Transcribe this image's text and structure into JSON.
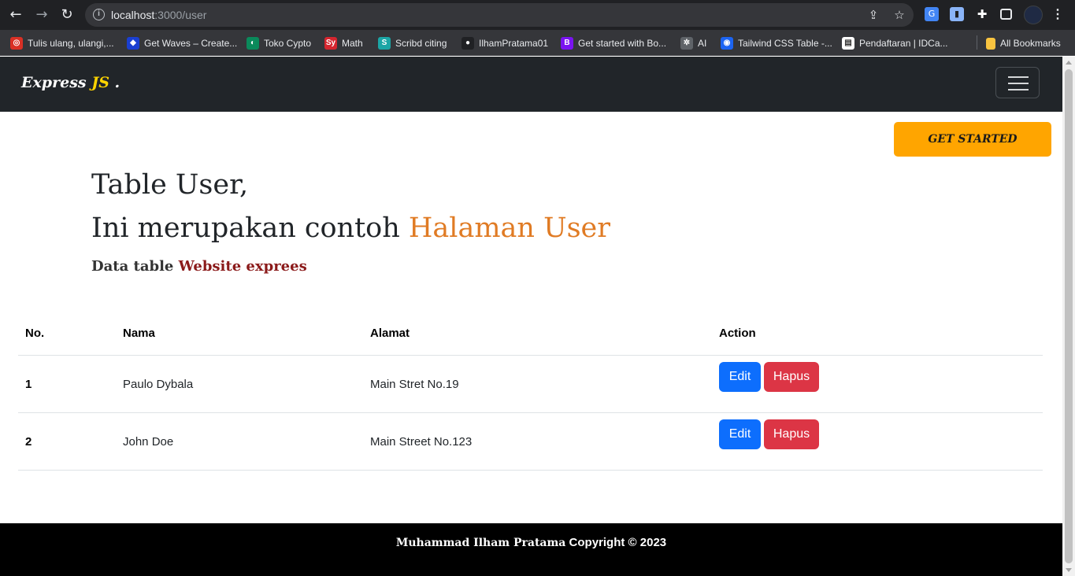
{
  "browser": {
    "url_host": "localhost",
    "url_rest": ":3000/user",
    "bookmarks": [
      {
        "label": "Tulis ulang, ulangi,...",
        "icon": "quillbot-icon",
        "color": "#d93025"
      },
      {
        "label": "Get Waves – Create...",
        "icon": "waves-icon",
        "color": "#1a3fd1"
      },
      {
        "label": "Toko Cypto",
        "icon": "crypto-icon",
        "color": "#0a8a5b"
      },
      {
        "label": "Math",
        "icon": "symbolab-icon",
        "color": "#d6262f"
      },
      {
        "label": "Scribd citing",
        "icon": "scribd-icon",
        "color": "#1ba5a5"
      },
      {
        "label": "IlhamPratama01",
        "icon": "github-icon",
        "color": "#202124"
      },
      {
        "label": "Get started with Bo...",
        "icon": "bootstrap-icon",
        "color": "#7a13f0"
      },
      {
        "label": "AI",
        "icon": "openai-icon",
        "color": "#5f6368"
      },
      {
        "label": "Tailwind CSS Table -...",
        "icon": "flowbite-icon",
        "color": "#1c64f2"
      },
      {
        "label": "Pendaftaran | IDCa...",
        "icon": "idcamp-icon",
        "color": "#ffffff"
      }
    ],
    "all_bookmarks": "All Bookmarks"
  },
  "navbar": {
    "brand_main": "Express ",
    "brand_js": "JS",
    "brand_dot": " ."
  },
  "hero": {
    "cta": "GET STARTED",
    "title_line1": "Table User,",
    "title_line2_prefix": "Ini merupakan contoh ",
    "title_line2_highlight": "Halaman User",
    "subtitle_prefix": "Data table ",
    "subtitle_highlight": "Website exprees"
  },
  "table": {
    "headers": [
      "No.",
      "Nama",
      "Alamat",
      "Action"
    ],
    "rows": [
      {
        "no": "1",
        "nama": "Paulo Dybala",
        "alamat": "Main Stret No.19",
        "edit": "Edit",
        "hapus": "Hapus"
      },
      {
        "no": "2",
        "nama": "John Doe",
        "alamat": "Main Street No.123",
        "edit": "Edit",
        "hapus": "Hapus"
      }
    ]
  },
  "footer": {
    "name": "Muhammad Ilham Pratama",
    "copyright": " Copyright © 2023"
  },
  "colors": {
    "navbar_bg": "#212529",
    "brand_accent": "#ffd400",
    "cta_bg": "#ffa500",
    "title_highlight": "#e07b24",
    "subtitle_highlight": "#8b1a1a",
    "edit_btn": "#0d6efd",
    "hapus_btn": "#dc3545",
    "footer_bg": "#000000"
  }
}
